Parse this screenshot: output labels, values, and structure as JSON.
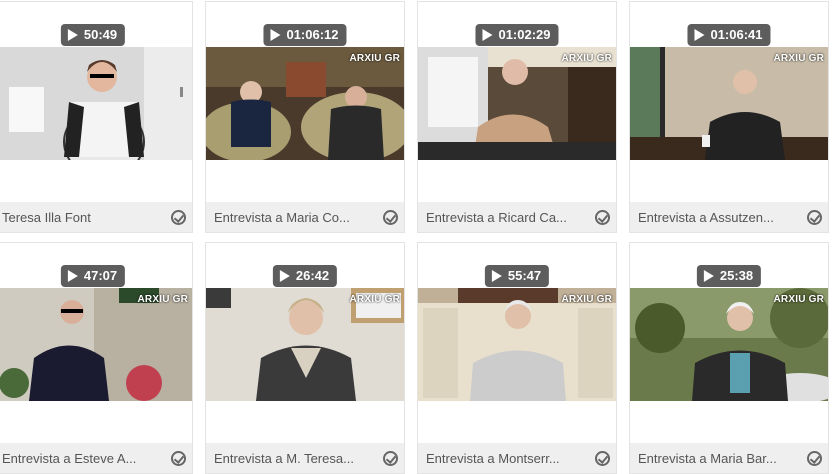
{
  "watermark": "ARXIU GR",
  "videos": [
    {
      "duration": "50:49",
      "title": "Teresa Illa Font"
    },
    {
      "duration": "01:06:12",
      "title": "Entrevista a Maria Co..."
    },
    {
      "duration": "01:02:29",
      "title": "Entrevista a Ricard Ca..."
    },
    {
      "duration": "01:06:41",
      "title": "Entrevista a Assutzen..."
    },
    {
      "duration": "47:07",
      "title": "Entrevista a Esteve A..."
    },
    {
      "duration": "26:42",
      "title": "Entrevista a M. Teresa..."
    },
    {
      "duration": "55:47",
      "title": "Entrevista a Montserr..."
    },
    {
      "duration": "25:38",
      "title": "Entrevista a Maria Bar..."
    }
  ]
}
